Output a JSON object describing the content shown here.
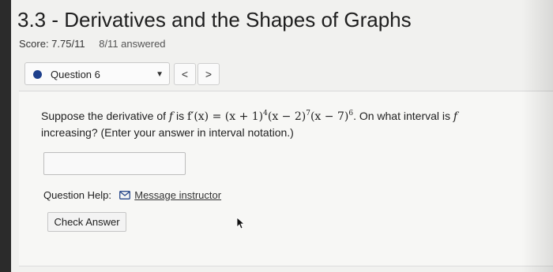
{
  "header": {
    "title": "3.3 - Derivatives and the Shapes of Graphs",
    "score": "Score: 7.75/11",
    "answered": "8/11 answered"
  },
  "question_nav": {
    "selected": "Question 6",
    "prev_label": "<",
    "next_label": ">",
    "dot_color": "#1d3f8c"
  },
  "question": {
    "text_before": "Suppose the derivative of ",
    "f": "f",
    "is": " is ",
    "expr_lhs": "f′(x) = (x + 1)",
    "exp1": "4",
    "expr_mid1": "(x − 2)",
    "exp2": "7",
    "expr_mid2": "(x − 7)",
    "exp3": "6",
    "after_expr": ". On what interval is ",
    "f2": "f",
    "line2": "increasing? (Enter your answer in interval notation.)"
  },
  "answer": {
    "value": ""
  },
  "help": {
    "label": "Question Help:",
    "link": "Message instructor"
  },
  "actions": {
    "check_answer": "Check Answer"
  }
}
